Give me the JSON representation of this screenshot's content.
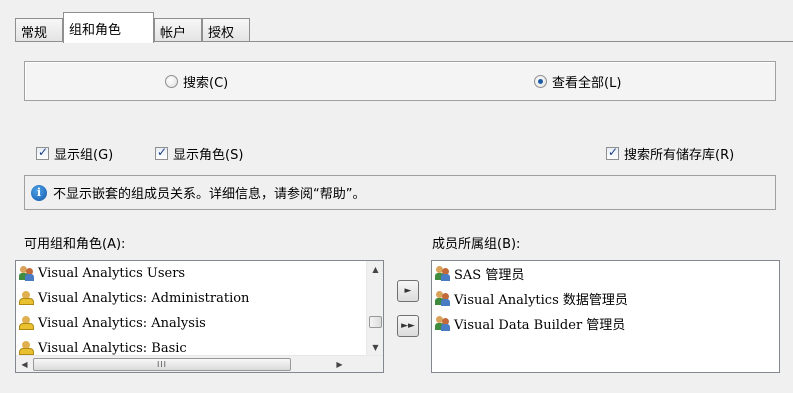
{
  "tabs": [
    {
      "label": "常规"
    },
    {
      "label": "组和角色"
    },
    {
      "label": "帐户"
    },
    {
      "label": "授权"
    }
  ],
  "radio": {
    "search_label": "搜索(C)",
    "view_all_label": "查看全部(L)",
    "selected": "view_all"
  },
  "checkboxes": {
    "show_groups": "显示组(G)",
    "show_roles": "显示角色(S)",
    "search_all_repos": "搜索所有储存库(R)"
  },
  "info": {
    "text": "不显示嵌套的组成员关系。详细信息，请参阅“帮助”。"
  },
  "available": {
    "label": "可用组和角色(A):",
    "items": [
      {
        "label": "Visual Analytics Users",
        "icon": "group-icon"
      },
      {
        "label": "Visual Analytics: Administration",
        "icon": "role-icon"
      },
      {
        "label": "Visual Analytics: Analysis",
        "icon": "role-icon"
      },
      {
        "label": "Visual Analytics: Basic",
        "icon": "role-icon"
      }
    ]
  },
  "member_of": {
    "label": "成员所属组(B):",
    "items": [
      {
        "label": "SAS 管理员",
        "icon": "group-icon"
      },
      {
        "label": "Visual Analytics 数据管理员",
        "icon": "group-icon"
      },
      {
        "label": "Visual Data Builder 管理员",
        "icon": "group-icon"
      }
    ]
  },
  "buttons": {
    "move_one": "►",
    "move_all": "►►"
  },
  "scroll": {
    "hthumb_grip": "III"
  }
}
